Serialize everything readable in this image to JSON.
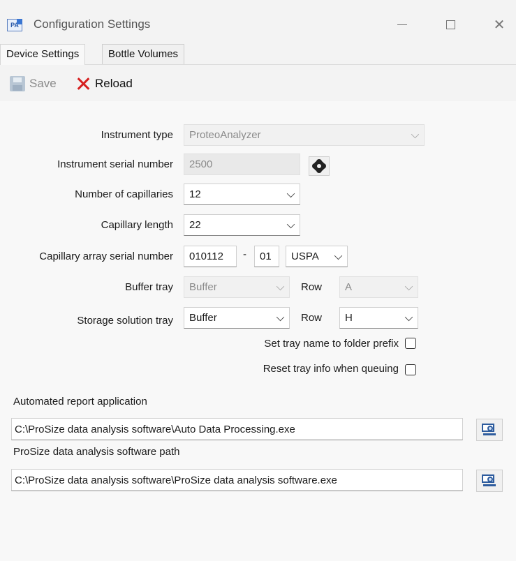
{
  "window": {
    "app_icon_text": "PA",
    "title": "Configuration Settings"
  },
  "tabs": [
    {
      "label": "Device Settings",
      "active": true
    },
    {
      "label": "Bottle Volumes",
      "active": false
    }
  ],
  "toolbar": {
    "save_label": "Save",
    "reload_label": "Reload"
  },
  "form": {
    "instrument_type": {
      "label": "Instrument type",
      "value": "ProteoAnalyzer"
    },
    "instrument_serial": {
      "label": "Instrument serial number",
      "value": "2500"
    },
    "num_capillaries": {
      "label": "Number of capillaries",
      "value": "12"
    },
    "capillary_length": {
      "label": "Capillary length",
      "value": "22"
    },
    "capillary_array_serial": {
      "label": "Capillary array serial number",
      "part1": "010112",
      "separator": "-",
      "part2": "01",
      "part3": "USPA"
    },
    "buffer_tray": {
      "label": "Buffer tray",
      "value": "Buffer",
      "row_label": "Row",
      "row_value": "A"
    },
    "storage_tray": {
      "label": "Storage solution tray",
      "value": "Buffer",
      "row_label": "Row",
      "row_value": "H"
    },
    "set_tray_name": {
      "label": "Set tray name to folder prefix",
      "checked": false
    },
    "reset_tray_info": {
      "label": "Reset tray info when queuing",
      "checked": false
    }
  },
  "paths": {
    "report_app": {
      "label": "Automated report application",
      "value": "C:\\ProSize data analysis software\\Auto Data Processing.exe"
    },
    "prosize_path": {
      "label": "ProSize data analysis software path",
      "value": "C:\\ProSize data analysis software\\ProSize data analysis software.exe"
    }
  }
}
